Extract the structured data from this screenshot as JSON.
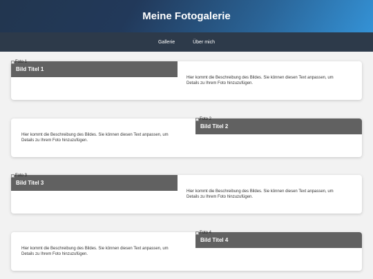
{
  "header": {
    "title": "Meine Fotogalerie"
  },
  "nav": {
    "items": [
      {
        "label": "Gallerie"
      },
      {
        "label": "Über mich"
      }
    ]
  },
  "gallery": {
    "items": [
      {
        "alt": "Foto 1",
        "title": "Bild Titel 1",
        "description": "Hier kommt die Beschreibung des Bildes. Sie können diesen Text anpassen, um Details zu Ihrem Foto hinzuzufügen."
      },
      {
        "alt": "Foto 2",
        "title": "Bild Titel 2",
        "description": "Hier kommt die Beschreibung des Bildes. Sie können diesen Text anpassen, um Details zu Ihrem Foto hinzuzufügen."
      },
      {
        "alt": "Foto 3",
        "title": "Bild Titel 3",
        "description": "Hier kommt die Beschreibung des Bildes. Sie können diesen Text anpassen, um Details zu Ihrem Foto hinzuzufügen."
      },
      {
        "alt": "Foto 4",
        "title": "Bild Titel 4",
        "description": "Hier kommt die Beschreibung des Bildes. Sie können diesen Text anpassen, um Details zu Ihrem Foto hinzuzufügen."
      }
    ]
  },
  "colors": {
    "header_gradient_start": "#22364f",
    "header_gradient_end": "#3492d6",
    "nav_background": "#2d3a4a",
    "photo_placeholder": "#616161",
    "page_background": "#f2f2f2"
  }
}
